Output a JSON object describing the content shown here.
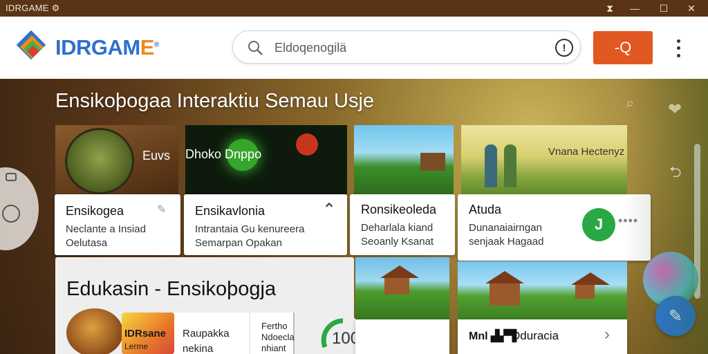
{
  "window": {
    "title": "IDRGAME ⚙",
    "controls": {
      "network": "⧗",
      "minimize": "—",
      "maximize": "☐",
      "close": "✕"
    }
  },
  "header": {
    "logo_text_main": "IDRGAM",
    "logo_text_end": "E",
    "logo_mark": "®",
    "search_placeholder": "Eldoqenogilä",
    "info_glyph": "!",
    "search_button_label": "-Q"
  },
  "main": {
    "heading": "Ensikoþogaa Interaktiu Semau Usje",
    "row1": [
      {
        "overlay": "Euvs",
        "title": "Ensikogea",
        "sub1": "Neclante a Insiad",
        "sub2": "Oelutasa"
      },
      {
        "overlay": "Dhoko Dnppo",
        "title": "Ensikavlonia",
        "sub1": "Intrantaia Gu kenureera",
        "sub2": "Semarpan Opakan"
      },
      {
        "overlay": "",
        "title": "Ronsikeoleda",
        "sub1": "Deharlala kiand",
        "sub2": "Seoanly Ksanat"
      },
      {
        "overlay": "Vnana Hectenyz",
        "title": "Atuda",
        "sub1": "Dunanaiairngan",
        "sub2": "senjaak Hagaad",
        "badge": "J"
      }
    ],
    "big_title": "Edukasin - Ensikoþogja",
    "row2": [
      {
        "thumb_label": "IDRsane",
        "thumb_sub": "Lerme",
        "title": "Raupakka",
        "sub": "nekina"
      },
      {
        "title": "Fertho",
        "sub1": "Ndoecla",
        "sub2": "nhiant",
        "score": "100"
      }
    ],
    "bottom_card": {
      "brand": "Mnl ▟▞▜",
      "title": "Dduracia",
      "chevron": "›"
    }
  },
  "icons": {
    "heart": "❤",
    "share": "⮌",
    "fab": "✎",
    "chevron_up": "⌃"
  }
}
